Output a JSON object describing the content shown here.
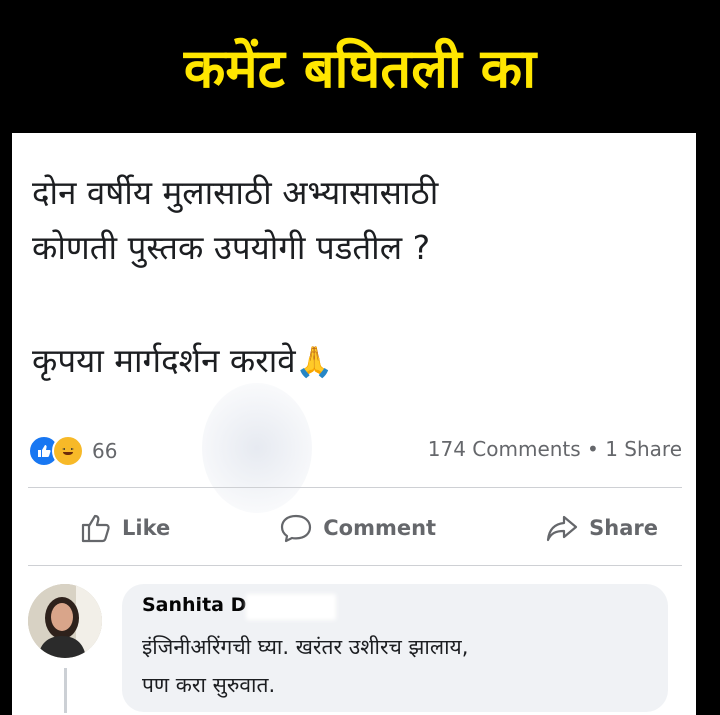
{
  "banner": {
    "title": "कमेंट बघितली का"
  },
  "post": {
    "line1": "दोन वर्षीय मुलासाठी अभ्यासासाठी",
    "line2": "कोणती पुस्तक उपयोगी पडतील ?",
    "line3": "कृपया मार्गदर्शन करावे",
    "emoji": "🙏",
    "reactions": {
      "icons": [
        "like-icon",
        "haha-icon"
      ],
      "count": "66"
    },
    "stats": "174 Comments • 1 Share"
  },
  "actions": {
    "like": "Like",
    "comment": "Comment",
    "share": "Share"
  },
  "comment": {
    "author": "Sanhita D",
    "text_line1": "इंजिनीअरिंगची घ्या. खरंतर उशीरच झालाय,",
    "text_line2": "पण करा सुरुवात."
  },
  "colors": {
    "banner_bg": "#000000",
    "banner_text": "#ffe600",
    "facebook_blue": "#1877f2",
    "muted": "#65676b"
  }
}
